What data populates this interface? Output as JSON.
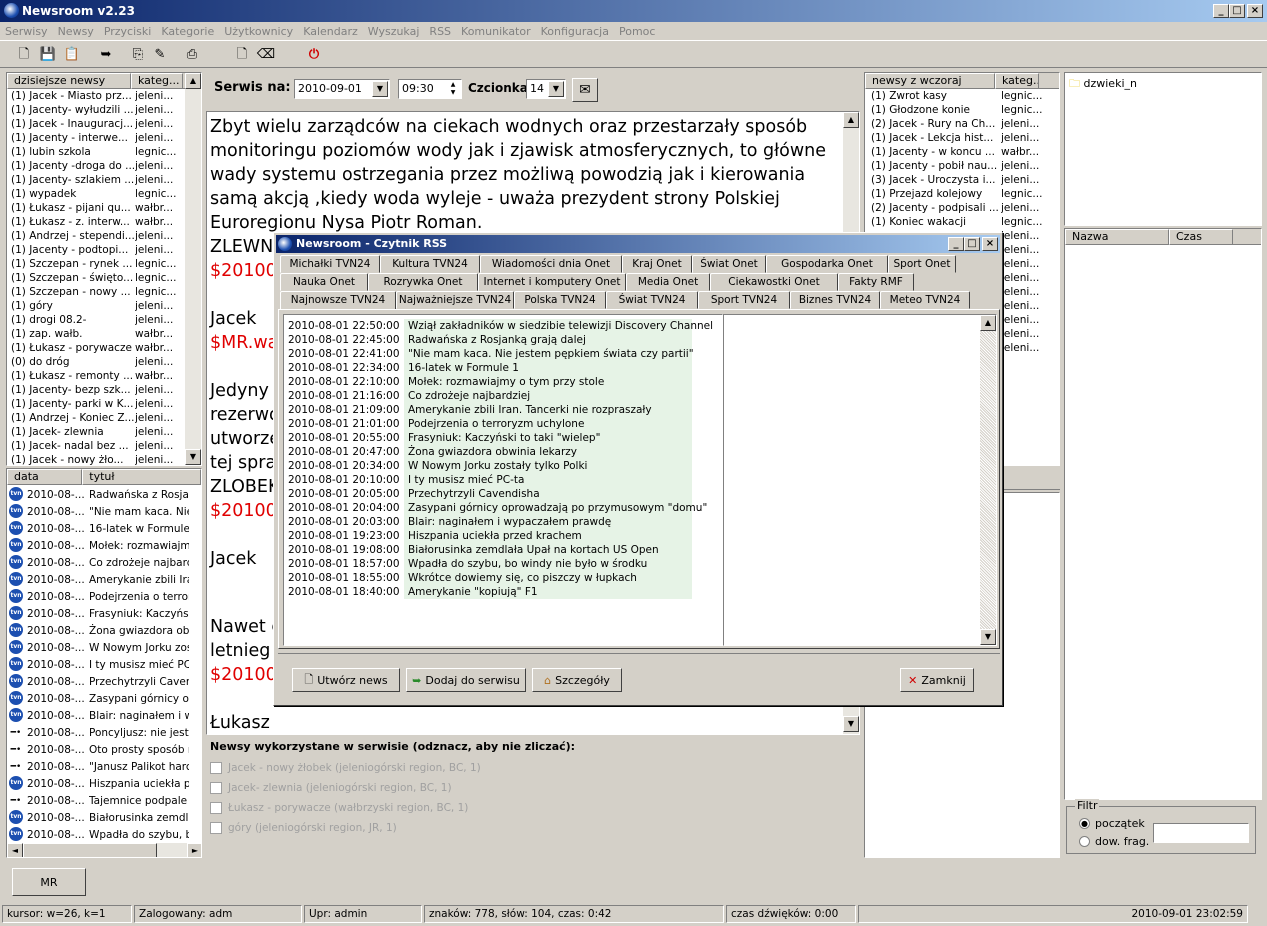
{
  "app": {
    "title": "Newsroom v2.23"
  },
  "menu": [
    "Serwisy",
    "Newsy",
    "Przyciski",
    "Kategorie",
    "Użytkownicy",
    "Kalendarz",
    "Wyszukaj",
    "RSS",
    "Komunikator",
    "Konfiguracja",
    "Pomoc"
  ],
  "today_list": {
    "col1": "dzisiejsze newsy",
    "col2": "kateg...",
    "rows": [
      [
        "(1) Jacek - Miasto prz...",
        "jeleni..."
      ],
      [
        "(1) Jacenty- wyłudzili ...",
        "jeleni..."
      ],
      [
        "(1) Jacek - Inauguracj...",
        "jeleni..."
      ],
      [
        "(1) Jacenty -  interwe...",
        "jeleni..."
      ],
      [
        "(1) lubin szkola",
        "legnic..."
      ],
      [
        "(1) Jacenty -droga do ...",
        "jeleni..."
      ],
      [
        "(1) Jacenty- szlakiem ...",
        "jeleni..."
      ],
      [
        "(1) wypadek",
        "legnic..."
      ],
      [
        "(1) Łukasz - pijani qu...",
        "wałbr..."
      ],
      [
        "(1) Łukasz - z. interw...",
        "wałbr..."
      ],
      [
        "(1) Andrzej - stependi...",
        "jeleni..."
      ],
      [
        "(1) Jacenty - podtopi...",
        "jeleni..."
      ],
      [
        "(1) Szczepan - rynek ...",
        "legnic..."
      ],
      [
        "(1) Szczepan - święto...",
        "legnic..."
      ],
      [
        "(1) Szczepan - nowy ...",
        "legnic..."
      ],
      [
        "(1) góry",
        "jeleni..."
      ],
      [
        "(1) drogi 08.2-",
        "jeleni..."
      ],
      [
        "(1) zap. wałb.",
        "wałbr..."
      ],
      [
        "(1) Łukasz - porywacze",
        "wałbr..."
      ],
      [
        "(0) do dróg",
        "jeleni..."
      ],
      [
        "(1) Łukasz - remonty ...",
        "wałbr..."
      ],
      [
        "(1) Jacenty- bezp szk...",
        "jeleni..."
      ],
      [
        "(1) Jacenty- parki w K...",
        "jeleni..."
      ],
      [
        "(1) Andrzej - Koniec Z...",
        "jeleni..."
      ],
      [
        "(1) Jacek- zlewnia",
        "jeleni..."
      ],
      [
        "(1) Jacek- nadal bez ...",
        "jeleni..."
      ],
      [
        "(1) Jacek - nowy żło...",
        "jeleni..."
      ]
    ]
  },
  "news_list": {
    "col1": "data",
    "col2": "tytuł",
    "rows": [
      [
        "tvn",
        "2010-08-...",
        "Radwańska z Rosjan"
      ],
      [
        "tvn",
        "2010-08-...",
        "\"Nie mam kaca. Nie"
      ],
      [
        "tvn",
        "2010-08-...",
        "16-latek w Formule 1"
      ],
      [
        "tvn",
        "2010-08-...",
        "Mołek: rozmawiajmy"
      ],
      [
        "tvn",
        "2010-08-...",
        "Co zdrożeje najbardz"
      ],
      [
        "tvn",
        "2010-08-...",
        "Amerykanie zbili Iran"
      ],
      [
        "tvn",
        "2010-08-...",
        "Podejrzenia o terrory"
      ],
      [
        "tvn",
        "2010-08-...",
        "Frasyniuk: Kaczyńsk"
      ],
      [
        "tvn",
        "2010-08-...",
        "Żona gwiazdora obw"
      ],
      [
        "tvn",
        "2010-08-...",
        "W Nowym Jorku zos"
      ],
      [
        "tvn",
        "2010-08-...",
        "I ty musisz mieć PC-t"
      ],
      [
        "tvn",
        "2010-08-...",
        "Przechytrzyli Cavenc"
      ],
      [
        "tvn",
        "2010-08-...",
        "Zasypani górnicy opr"
      ],
      [
        "tvn",
        "2010-08-...",
        "Blair: naginałem i wy"
      ],
      [
        "rmf",
        "2010-08-...",
        "Poncyljusz: nie jeste"
      ],
      [
        "rmf",
        "2010-08-...",
        "Oto prosty sposób na"
      ],
      [
        "rmf",
        "2010-08-...",
        "\"Janusz Palikot harc"
      ],
      [
        "tvn",
        "2010-08-...",
        "Hiszpania uciekła pr"
      ],
      [
        "rmf",
        "2010-08-...",
        "Tajemnice podpale"
      ],
      [
        "tvn",
        "2010-08-...",
        "Białorusinka zemdlał"
      ],
      [
        "tvn",
        "2010-08-...",
        "Wpadła do szybu, b"
      ]
    ]
  },
  "editor": {
    "serwis_label": "Serwis na:",
    "date": "2010-09-01",
    "time": "09:30",
    "font_label": "Czcionka:",
    "font_size": "14",
    "para1": "Zbyt wielu zarządców na ciekach wodnych oraz przestarzały sposób monitoringu poziomów wody jak i zjawisk atmosferycznych, to główne wady systemu ostrzegania przez możliwą powodzią jak i kierowania samą akcją ,kiedy woda wyleje - uważa prezydent strony Polskiej Euroregionu Nysa Piotr Roman.",
    "l1": "ZLEWN",
    "l2": "$20100",
    "l3": "Jacek",
    "l4": "$MR.wa",
    "l5": "Jedyny",
    "l6": "rezerwo",
    "l7": "utworze",
    "l8": "tej spraw",
    "l9": "ZLOBEK",
    "l10": "$20100",
    "l11": "Jacek",
    "l12": "Nawet c",
    "l13": "letnieg",
    "l14": "$20100",
    "l15": "Łukasz",
    "used_header": "Newsy wykorzystane w serwisie (odznacz, aby nie zliczać):",
    "used": [
      "Jacek -  nowy żłobek (jeleniogórski region, BC, 1)",
      "Jacek- zlewnia (jeleniogórski region, BC, 1)",
      "Łukasz - porywacze (wałbrzyski region, BC, 1)",
      "góry (jeleniogórski region, JR, 1)"
    ]
  },
  "yesterday": {
    "col1": "newsy z wczoraj",
    "col2": "kateg...",
    "rows": [
      [
        "(1) Zwrot kasy",
        "legnic..."
      ],
      [
        "(1) Głodzone konie",
        "legnic..."
      ],
      [
        "(2) Jacek - Rury na Ch...",
        "jeleni..."
      ],
      [
        "(1) Jacek - Lekcja hist...",
        "jeleni..."
      ],
      [
        "(1) Jacenty - w koncu ...",
        "wałbr..."
      ],
      [
        "(1) Jacenty - pobił nau...",
        "jeleni..."
      ],
      [
        "(3) Jacek - Uroczysta i...",
        "jeleni..."
      ],
      [
        "(1) Przejazd kolejowy",
        "legnic..."
      ],
      [
        "(2) Jacenty - podpisali ...",
        "jeleni..."
      ],
      [
        "(1) Koniec wakacji",
        "legnic..."
      ],
      [
        "",
        "jeleni..."
      ],
      [
        "",
        "jeleni..."
      ],
      [
        "",
        "jeleni..."
      ],
      [
        "",
        "jeleni..."
      ],
      [
        "",
        "jeleni..."
      ],
      [
        "",
        "jeleni..."
      ],
      [
        "",
        "jeleni..."
      ],
      [
        "",
        "jeleni..."
      ],
      [
        "",
        "jeleni..."
      ]
    ]
  },
  "folder": {
    "name": "dzwieki_n"
  },
  "sounds": {
    "col1": "Nazwa",
    "col2": "Czas"
  },
  "filter": {
    "legend": "Filtr",
    "opt1": "początek",
    "opt2": "dow. frag."
  },
  "bottom": {
    "mr": "MR"
  },
  "status": {
    "cursor": "kursor: w=26, k=1",
    "user": "Zalogowany: adm",
    "upr": "Upr: admin",
    "stats": "znaków: 778, słów: 104, czas: 0:42",
    "audio": "czas dźwięków: 0:00",
    "datetime": "2010-09-01 23:02:59"
  },
  "rss": {
    "title": "Newsroom - Czytnik RSS",
    "tabs1": [
      "Michałki TVN24",
      "Kultura TVN24",
      "Wiadomości dnia Onet",
      "Kraj Onet",
      "Świat Onet",
      "Gospodarka Onet",
      "Sport Onet"
    ],
    "tabs2": [
      "Nauka Onet",
      "Rozrywka Onet",
      "Internet i komputery Onet",
      "Media Onet",
      "Ciekawostki Onet",
      "Fakty RMF"
    ],
    "tabs3": [
      "Najnowsze TVN24",
      "Najważniejsze TVN24",
      "Polska TVN24",
      "Świat TVN24",
      "Sport TVN24",
      "Biznes TVN24",
      "Meteo TVN24"
    ],
    "items": [
      [
        "2010-08-01 22:50:00",
        "Wziął zakładników w siedzibie telewizji Discovery Channel"
      ],
      [
        "2010-08-01 22:45:00",
        "Radwańska z Rosjanką grają dalej"
      ],
      [
        "2010-08-01 22:41:00",
        "\"Nie mam kaca. Nie jestem pępkiem świata czy partii\""
      ],
      [
        "2010-08-01 22:34:00",
        "16-latek w Formule 1"
      ],
      [
        "2010-08-01 22:10:00",
        "Mołek: rozmawiajmy o tym przy stole"
      ],
      [
        "2010-08-01 21:16:00",
        "Co zdrożeje najbardziej"
      ],
      [
        "2010-08-01 21:09:00",
        "Amerykanie zbili Iran. Tancerki nie rozpraszały"
      ],
      [
        "2010-08-01 21:01:00",
        "Podejrzenia o terroryzm uchylone"
      ],
      [
        "2010-08-01 20:55:00",
        "Frasyniuk: Kaczyński to taki \"wielep\""
      ],
      [
        "2010-08-01 20:47:00",
        "Żona gwiazdora obwinia lekarzy"
      ],
      [
        "2010-08-01 20:34:00",
        "W Nowym Jorku zostały tylko Polki"
      ],
      [
        "2010-08-01 20:10:00",
        "I ty musisz mieć PC-ta"
      ],
      [
        "2010-08-01 20:05:00",
        "Przechytrzyli Cavendisha"
      ],
      [
        "2010-08-01 20:04:00",
        "Zasypani górnicy oprowadzają po przymusowym \"domu\""
      ],
      [
        "2010-08-01 20:03:00",
        "Blair: naginałem i wypaczałem prawdę"
      ],
      [
        "2010-08-01 19:23:00",
        "Hiszpania uciekła przed krachem"
      ],
      [
        "2010-08-01 19:08:00",
        "Białorusinka zemdlała Upał na kortach US Open"
      ],
      [
        "2010-08-01 18:57:00",
        "Wpadła do szybu, bo windy nie było w środku"
      ],
      [
        "2010-08-01 18:55:00",
        "Wkrótce dowiemy się, co piszczy w łupkach"
      ],
      [
        "2010-08-01 18:40:00",
        "Amerykanie \"kopiują\" F1"
      ]
    ],
    "btn_create": "Utwórz news",
    "btn_add": "Dodaj do serwisu",
    "btn_details": "Szczegóły",
    "btn_close": "Zamknij"
  }
}
